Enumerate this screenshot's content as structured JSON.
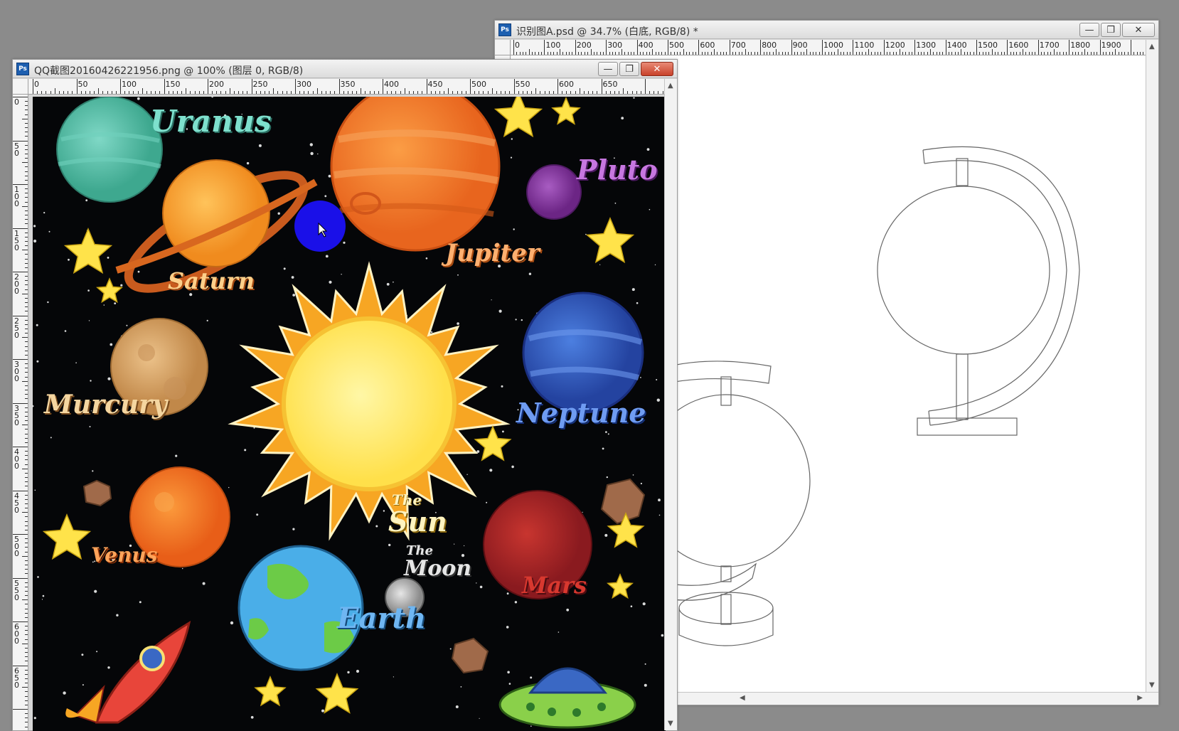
{
  "windows": {
    "back": {
      "title": "识别图A.psd @ 34.7% (白底, RGB/8) *",
      "ruler_labels": [
        "0",
        "100",
        "200",
        "300",
        "400",
        "500",
        "600",
        "700",
        "800",
        "900",
        "1000",
        "1100",
        "1200",
        "1300",
        "1400",
        "1500",
        "1600",
        "1700",
        "1800",
        "1900"
      ]
    },
    "front": {
      "title": "QQ截图20160426221956.png @ 100% (图层 0, RGB/8)",
      "hruler_labels": [
        "0",
        "50",
        "100",
        "150",
        "200",
        "250",
        "300",
        "350",
        "400",
        "450",
        "500",
        "550",
        "600",
        "650"
      ],
      "vruler_labels": [
        "0",
        "50",
        "100",
        "150",
        "200",
        "250",
        "300",
        "350",
        "400",
        "450",
        "500",
        "550",
        "600",
        "650"
      ]
    }
  },
  "app_icon_label": "Ps",
  "window_buttons": {
    "minimize": "—",
    "restore": "❐",
    "close": "✕"
  },
  "planets": {
    "uranus": "Uranus",
    "saturn": "Saturn",
    "jupiter": "Jupiter",
    "pluto": "Pluto",
    "mercury": "Murcury",
    "neptune": "Neptune",
    "venus": "Venus",
    "sun_the": "The",
    "sun": "Sun",
    "moon_the": "The",
    "moon": "Moon",
    "mars": "Mars",
    "earth": "Earth"
  },
  "colors": {
    "uranus": "#5cc7b4",
    "saturn": "#f39a2a",
    "jupiter": "#f07d2c",
    "pluto": "#8e3fa8",
    "mercury": "#d9a66a",
    "neptune": "#2f5fc0",
    "venus": "#f07a24",
    "sun": "#ffe86a",
    "mars": "#b0252a",
    "earth": "#4aaee8",
    "moon": "#9c9c9c",
    "brush": "#1a10e8"
  },
  "icons": {
    "cursor": "move-cursor-icon",
    "rocket": "rocket-icon",
    "ufo": "ufo-icon",
    "globe_sketch": "globe-outline-icon"
  }
}
